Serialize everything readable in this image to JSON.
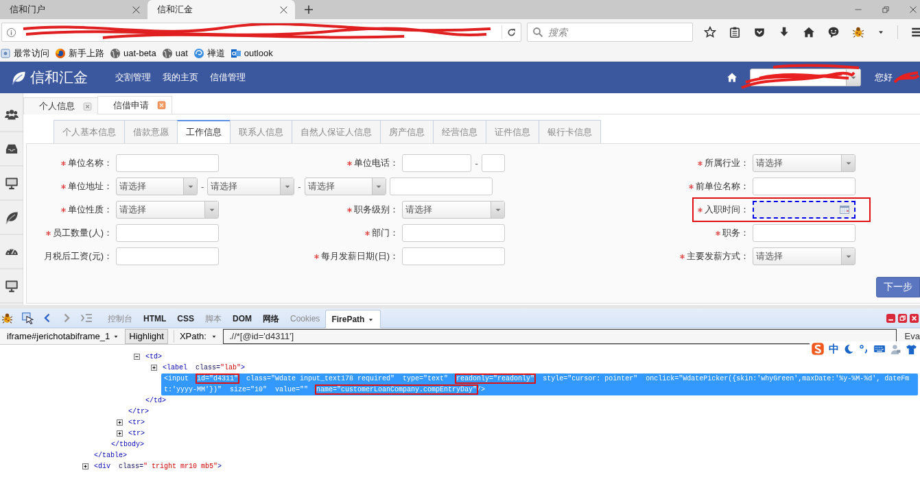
{
  "browser": {
    "tabs": [
      {
        "label": "信和门户",
        "selected": false
      },
      {
        "label": "信和汇金",
        "selected": true
      }
    ],
    "search": {
      "placeholder": "搜索"
    },
    "bookmarks": [
      {
        "label": "最常访问",
        "kind": "folder"
      },
      {
        "label": "新手上路",
        "kind": "firefox"
      },
      {
        "label": "uat-beta",
        "kind": "globe"
      },
      {
        "label": "uat",
        "kind": "globe"
      },
      {
        "label": "禅道",
        "kind": "swirl"
      },
      {
        "label": "outlook",
        "kind": "mail"
      }
    ]
  },
  "app": {
    "brand": "信和汇金",
    "menu": [
      "交割管理",
      "我的主页",
      "信借管理"
    ],
    "greeting": "您好"
  },
  "page_tabs": [
    {
      "label": "个人信息",
      "selected": false
    },
    {
      "label": "信借申请",
      "selected": true
    }
  ],
  "form_tabs": [
    {
      "label": "个人基本信息",
      "selected": false
    },
    {
      "label": "借款意愿",
      "selected": false
    },
    {
      "label": "工作信息",
      "selected": true
    },
    {
      "label": "联系人信息",
      "selected": false
    },
    {
      "label": "自然人保证人信息",
      "selected": false
    },
    {
      "label": "房产信息",
      "selected": false
    },
    {
      "label": "经营信息",
      "selected": false
    },
    {
      "label": "证件信息",
      "selected": false
    },
    {
      "label": "银行卡信息",
      "selected": false
    }
  ],
  "form": {
    "rows": [
      [
        {
          "label": "单位名称：",
          "required": true,
          "kind": "text"
        },
        {
          "label": "单位电话：",
          "required": true,
          "kind": "phone",
          "separator": "-"
        },
        {
          "label": "所属行业：",
          "required": true,
          "kind": "select",
          "placeholder": "请选择"
        }
      ],
      [
        {
          "label": "单位地址：",
          "required": true,
          "kind": "address",
          "colspan": 2,
          "placeholders": [
            "请选择",
            "请选择",
            "请选择"
          ],
          "separators": [
            "-",
            "-"
          ]
        },
        {
          "label": "前单位名称：",
          "required": true,
          "kind": "text"
        }
      ],
      [
        {
          "label": "单位性质：",
          "required": true,
          "kind": "select",
          "placeholder": "请选择"
        },
        {
          "label": "职务级别：",
          "required": true,
          "kind": "select",
          "placeholder": "请选择"
        },
        {
          "label": "入职时间：",
          "required": true,
          "kind": "date",
          "focused": true,
          "annotated": true
        }
      ],
      [
        {
          "label": "员工数量(人)：",
          "required": true,
          "kind": "text"
        },
        {
          "label": "部门：",
          "required": true,
          "kind": "text"
        },
        {
          "label": "职务：",
          "required": true,
          "kind": "text"
        }
      ],
      [
        {
          "label": "月税后工资(元)：",
          "required": false,
          "kind": "text"
        },
        {
          "label": "每月发薪日期(日)：",
          "required": true,
          "kind": "text"
        },
        {
          "label": "主要发薪方式：",
          "required": true,
          "kind": "select",
          "placeholder": "请选择"
        }
      ]
    ],
    "next_button": "下一步"
  },
  "devtools": {
    "panels": [
      {
        "label": "控制台",
        "selected": false,
        "disabled": true
      },
      {
        "label": "HTML",
        "selected": false,
        "disabled": false
      },
      {
        "label": "CSS",
        "selected": false,
        "disabled": false
      },
      {
        "label": "脚本",
        "selected": false,
        "disabled": true
      },
      {
        "label": "DOM",
        "selected": false,
        "disabled": false
      },
      {
        "label": "网络",
        "selected": false,
        "disabled": false
      },
      {
        "label": "Cookies",
        "selected": false,
        "disabled": true
      },
      {
        "label": "FirePath",
        "selected": true,
        "disabled": false
      }
    ],
    "frame": "iframe#jerichotabiframe_1",
    "highlight": "Highlight",
    "xpath_label": "XPath:",
    "xpath": ".//*[@id='d4311']",
    "eval": "Eva",
    "tree": [
      {
        "children": [
          {
            "children": [
              {
                "children": [
                  {
                    "open": [
                      {
                        "t": "<td>",
                        "kind": "tag"
                      }
                    ],
                    "expanded": true,
                    "children": [
                      {
                        "open": [
                          {
                            "t": "<label",
                            "kind": "tag"
                          },
                          {
                            "t": "  class=",
                            "kind": "attr"
                          },
                          {
                            "t": "\"lab\"",
                            "kind": "value"
                          },
                          {
                            "t": ">",
                            "kind": "tag"
                          }
                        ],
                        "expanded": false
                      },
                      {
                        "selected": true,
                        "open": [
                          {
                            "t": "<input  ",
                            "kind": "tag"
                          },
                          {
                            "t": "id=\"d4311\"",
                            "kind": "attr",
                            "boxed": true
                          },
                          {
                            "t": "  class=\"Wdate input_text178 required\"  type=\"text\"  ",
                            "kind": "attr"
                          },
                          {
                            "t": "readonly=\"readonly\"",
                            "kind": "attr",
                            "boxed": true
                          },
                          {
                            "t": "  style=\"cursor: pointer\"  onclick=\"WdatePicker({skin:'whyGreen',maxDate:'%y-%M-%d', dateFmt:'yyyy-MM'})\"  size=\"10\"  value=\"\"  ",
                            "kind": "attr"
                          },
                          {
                            "t": "name=\"customerLoanCompany.compEntryDay\"",
                            "kind": "attr",
                            "boxed": true
                          },
                          {
                            "t": "/>",
                            "kind": "tag"
                          }
                        ]
                      }
                    ],
                    "close": [
                      {
                        "t": "</td>",
                        "kind": "tag"
                      }
                    ]
                  }
                ],
                "close": [
                  {
                    "t": "</tr>",
                    "kind": "tag"
                  }
                ]
              },
              {
                "open": [
                  {
                    "t": "<tr>",
                    "kind": "tag"
                  }
                ],
                "expanded": false
              },
              {
                "open": [
                  {
                    "t": "<tr>",
                    "kind": "tag"
                  }
                ],
                "expanded": false
              }
            ],
            "close": [
              {
                "t": "</tbody>",
                "kind": "tag"
              }
            ]
          }
        ],
        "close": [
          {
            "t": "</table>",
            "kind": "tag"
          }
        ]
      },
      {
        "open": [
          {
            "t": "<div",
            "kind": "tag"
          },
          {
            "t": "  class=",
            "kind": "attr"
          },
          {
            "t": "\" tright mr10 mb5\"",
            "kind": "value"
          },
          {
            "t": ">",
            "kind": "tag"
          }
        ],
        "expanded": false
      }
    ]
  },
  "ime": {
    "mode": "中"
  }
}
